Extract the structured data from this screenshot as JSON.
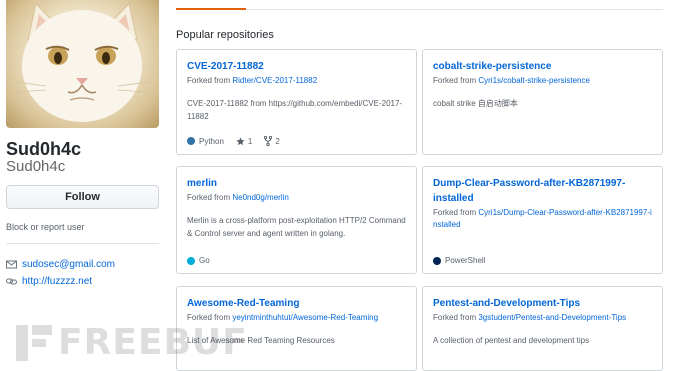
{
  "profile": {
    "display_name": "Sud0h4c",
    "username": "Sud0h4c",
    "follow_label": "Follow",
    "block_label": "Block or report user",
    "email": "sudosec@gmail.com",
    "website": "http://fuzzzz.net"
  },
  "section_title": "Popular repositories",
  "repos": [
    {
      "name": "CVE-2017-11882",
      "forked_prefix": "Forked from",
      "forked_from": "Ridter/CVE-2017-11882",
      "description": "CVE-2017-11882 from https://github.com/embedi/CVE-2017-11882",
      "language": "Python",
      "language_color": "#3572A5",
      "stars": "1",
      "forks": "2"
    },
    {
      "name": "cobalt-strike-persistence",
      "forked_prefix": "Forked from",
      "forked_from": "Cyri1s/cobalt-strike-persistence",
      "description": "cobalt strike 自启动脚本"
    },
    {
      "name": "merlin",
      "forked_prefix": "Forked from",
      "forked_from": "Ne0nd0g/merlin",
      "description": "Merlin is a cross-platform post-exploitation HTTP/2 Command & Control server and agent written in golang.",
      "language": "Go",
      "language_color": "#00ADD8"
    },
    {
      "name": "Dump-Clear-Password-after-KB2871997-installed",
      "forked_prefix": "Forked from",
      "forked_from": "Cyri1s/Dump-Clear-Password-after-KB2871997-installed",
      "description": "",
      "language": "PowerShell",
      "language_color": "#012456"
    },
    {
      "name": "Awesome-Red-Teaming",
      "forked_prefix": "Forked from",
      "forked_from": "yeyintminthuhtut/Awesome-Red-Teaming",
      "description": "List of Awesome Red Teaming Resources"
    },
    {
      "name": "Pentest-and-Development-Tips",
      "forked_prefix": "Forked from",
      "forked_from": "3gstudent/Pentest-and-Development-Tips",
      "description": "A collection of pentest and development tips"
    }
  ],
  "watermark": "FREEBUF",
  "colors": {
    "link": "#0366d6",
    "tab_accent": "#e36209",
    "border": "#d1d5da"
  }
}
